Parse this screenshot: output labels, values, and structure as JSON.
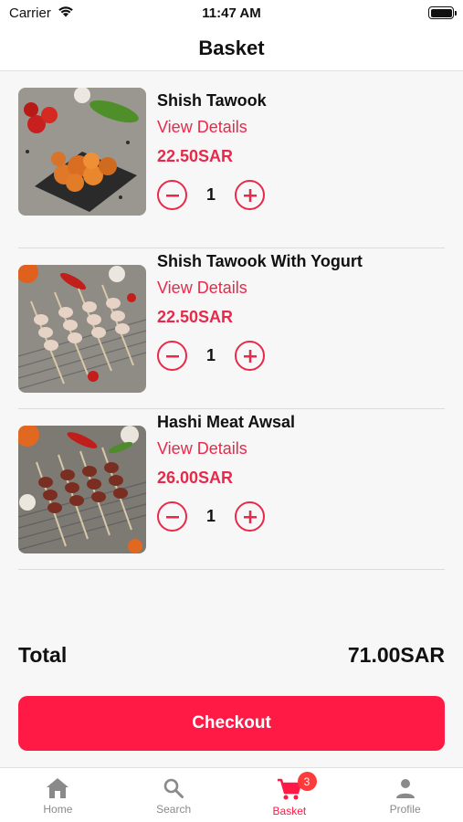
{
  "status_bar": {
    "carrier": "Carrier",
    "time": "11:47 AM"
  },
  "header": {
    "title": "Basket"
  },
  "items": [
    {
      "name": "Shish Tawook",
      "details_label": "View Details",
      "price": "22.50SAR",
      "quantity": "1"
    },
    {
      "name": "Shish Tawook With Yogurt",
      "details_label": "View Details",
      "price": "22.50SAR",
      "quantity": "1"
    },
    {
      "name": "Hashi Meat Awsal",
      "details_label": "View Details",
      "price": "26.00SAR",
      "quantity": "1"
    }
  ],
  "total": {
    "label": "Total",
    "value": "71.00SAR"
  },
  "checkout_label": "Checkout",
  "tabs": [
    {
      "label": "Home",
      "icon": "home-icon"
    },
    {
      "label": "Search",
      "icon": "search-icon"
    },
    {
      "label": "Basket",
      "icon": "cart-icon",
      "badge": "3"
    },
    {
      "label": "Profile",
      "icon": "profile-icon"
    }
  ],
  "colors": {
    "accent": "#e8294a",
    "button": "#fe1a45",
    "badge": "#fe3a3a"
  }
}
